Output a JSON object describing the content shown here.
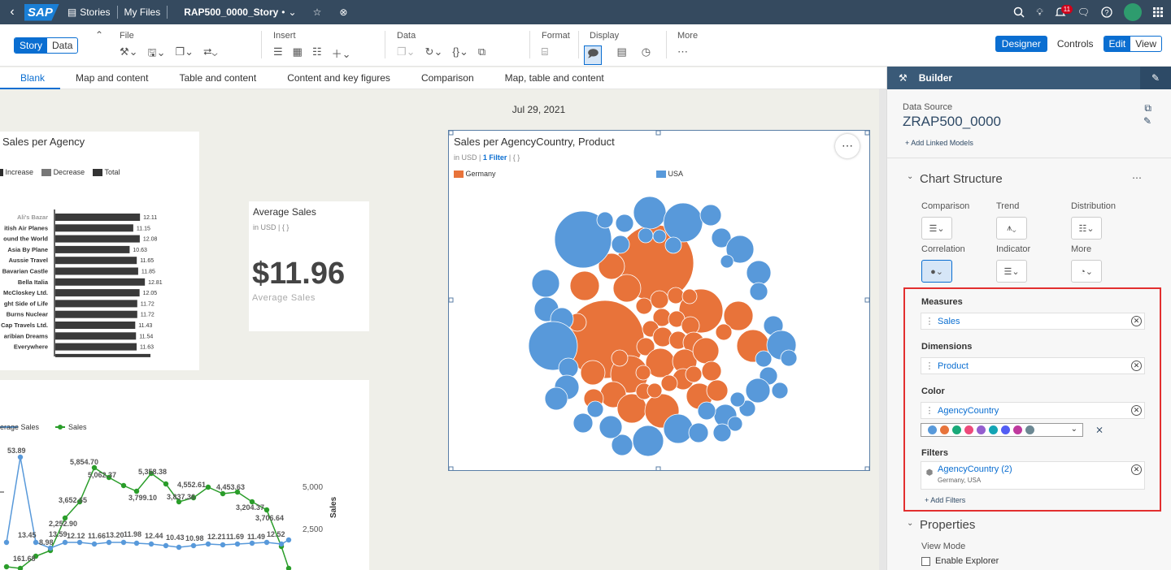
{
  "shell": {
    "logo": "SAP",
    "stories": "Stories",
    "my_files": "My Files",
    "story_name": "RAP500_0000_Story",
    "dirty_mark": "•",
    "notification_count": "11"
  },
  "toolbar": {
    "story_label": "Story",
    "data_label": "Data",
    "file_label": "File",
    "insert_label": "Insert",
    "data_group_label": "Data",
    "format_label": "Format",
    "display_label": "Display",
    "more_label": "More",
    "designer_label": "Designer",
    "controls_label": "Controls",
    "edit_label": "Edit",
    "view_label": "View"
  },
  "tabs": [
    "Blank",
    "Map and content",
    "Table and content",
    "Content and key figures",
    "Comparison",
    "Map, table and content"
  ],
  "canvas": {
    "date": "Jul 29, 2021",
    "waterfall": {
      "title": "Sales per Agency",
      "legend": [
        "Increase",
        "Decrease",
        "Total"
      ],
      "rows": [
        {
          "label": "Ali's Bazar",
          "value": 12.11
        },
        {
          "label": "itish Air Planes",
          "value": 11.15
        },
        {
          "label": "ound the World",
          "value": 12.08
        },
        {
          "label": "Asia By Plane",
          "value": 10.63
        },
        {
          "label": "Aussie Travel",
          "value": 11.65
        },
        {
          "label": "Bavarian Castle",
          "value": 11.85
        },
        {
          "label": "Bella Italia",
          "value": 12.81
        },
        {
          "label": "McCloskey Ltd.",
          "value": 12.05
        },
        {
          "label": "ght Side of Life",
          "value": 11.72
        },
        {
          "label": "Burns Nuclear",
          "value": 11.72
        },
        {
          "label": "Cap Travels Ltd.",
          "value": 11.43
        },
        {
          "label": "aribian Dreams",
          "value": 11.54
        },
        {
          "label": "Everywhere",
          "value": 11.63
        }
      ]
    },
    "kpi": {
      "title": "Average Sales",
      "unit": "in USD",
      "braces": "{ }",
      "value": "$11.96",
      "caption": "Average Sales"
    },
    "bubble": {
      "title": "Sales per AgencyCountry, Product",
      "unit": "in USD",
      "filter": "1 Filter",
      "braces": "{ }",
      "legend": [
        {
          "name": "Germany",
          "color": "#e8733a"
        },
        {
          "name": "USA",
          "color": "#5899da"
        }
      ]
    },
    "line": {
      "legend": [
        "erage Sales",
        "Sales"
      ],
      "y_axis_label": "Sales",
      "y_ticks": [
        "5,000",
        "2,500"
      ],
      "green_labels": [
        "5,854.70",
        "5,062.37",
        "5,358.38",
        "3,652.65",
        "3,799.10",
        "4,552.61",
        "3,837.36",
        "4,453.63",
        "3,204.37",
        "3,706.64",
        "2,252.90",
        "161.68",
        "8.98"
      ],
      "blue_labels": [
        "53.89",
        "13.45",
        "13.59",
        "12.12",
        "11.66",
        "13.20",
        "11.98",
        "12.44",
        "10.43",
        "10.98",
        "12.21",
        "11.69",
        "11.49",
        "12.52"
      ]
    }
  },
  "builder": {
    "title": "Builder",
    "data_source_label": "Data Source",
    "data_source": "ZRAP500_0000",
    "add_linked": "Add Linked Models",
    "chart_structure": "Chart Structure",
    "chart_types": [
      "Comparison",
      "Trend",
      "Distribution",
      "Correlation",
      "Indicator",
      "More"
    ],
    "measures_label": "Measures",
    "measure": "Sales",
    "dimensions_label": "Dimensions",
    "dimension": "Product",
    "color_label": "Color",
    "color_dim": "AgencyCountry",
    "palette": [
      "#5899da",
      "#e8743b",
      "#19a979",
      "#ed4a7b",
      "#945ecf",
      "#13a4b4",
      "#525df4",
      "#bf399e",
      "#6c8893"
    ],
    "filters_label": "Filters",
    "filter_name": "AgencyCountry (2)",
    "filter_values": "Germany, USA",
    "add_filters": "Add Filters",
    "properties": "Properties",
    "view_mode": "View Mode",
    "enable_explorer": "Enable Explorer"
  }
}
